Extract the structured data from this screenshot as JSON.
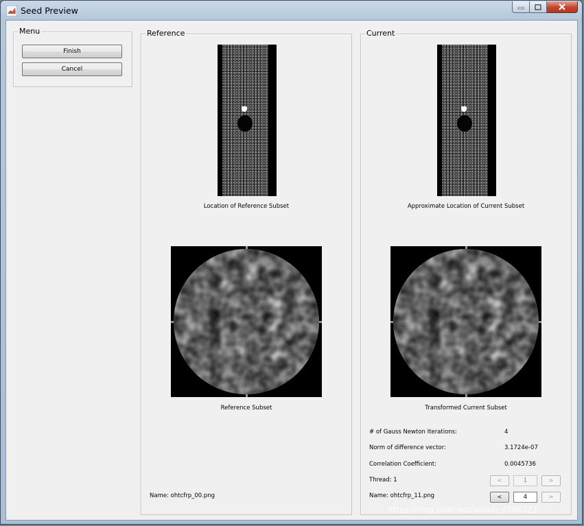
{
  "window": {
    "title": "Seed Preview"
  },
  "menu": {
    "title": "Menu",
    "finish_label": "Finish",
    "cancel_label": "Cancel"
  },
  "reference": {
    "title": "Reference",
    "location_caption": "Location of Reference Subset",
    "subset_caption": "Reference Subset",
    "name_text": "Name: ohtcfrp_00.png"
  },
  "current": {
    "title": "Current",
    "location_caption": "Approximate Location of Current Subset",
    "subset_caption": "Transformed Current Subset",
    "stats": [
      {
        "label": "# of Gauss Newton Iterations:",
        "value": "4"
      },
      {
        "label": "Norm of difference vector:",
        "value": "3.1724e-07"
      },
      {
        "label": "Correlation Coefficient:",
        "value": "0.0045736"
      }
    ],
    "thread_text": "Thread: 1",
    "thread_value": "1",
    "name_text": "Name: ohtcfrp_11.png",
    "image_value": "4",
    "prev_label": "<",
    "next_label": ">"
  },
  "watermark": "https://blog.csdn.net/weixin_4564523"
}
